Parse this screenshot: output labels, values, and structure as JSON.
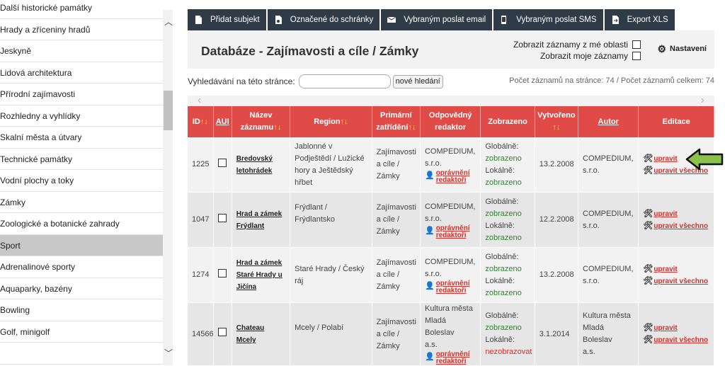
{
  "sidebar": {
    "items": [
      {
        "label": "Další historické památky"
      },
      {
        "label": "Hrady a zříceniny hradů"
      },
      {
        "label": "Jeskyně"
      },
      {
        "label": "Lidová architektura"
      },
      {
        "label": "Přírodní zajímavosti"
      },
      {
        "label": "Rozhledny a vyhlídky"
      },
      {
        "label": "Skalní města a útvary"
      },
      {
        "label": "Technické památky"
      },
      {
        "label": "Vodní plochy a toky"
      },
      {
        "label": "Zámky"
      },
      {
        "label": "Zoologické a botanické zahrady"
      },
      {
        "label": "Sport",
        "active": true
      },
      {
        "label": "Adrenalinové sporty"
      },
      {
        "label": "Aquaparky, bazény"
      },
      {
        "label": "Bowling"
      },
      {
        "label": "Golf, minigolf"
      },
      {
        "label": ""
      }
    ]
  },
  "toolbar": {
    "add": "Přidat subjekt",
    "clipboard": "Označené do schránky",
    "email": "Vybraným poslat email",
    "sms": "Vybraným poslat SMS",
    "export": "Export XLS"
  },
  "header": {
    "title": "Databáze - Zajímavosti a cíle / Zámky",
    "check_area": "Zobrazit záznamy z mé oblasti",
    "check_mine": "Zobrazit moje záznamy",
    "settings": "Nastavení"
  },
  "search": {
    "label": "Vyhledávání na této stránce:",
    "value": "",
    "button": "nové hledání",
    "count": "Počet záznamů na stránce: 74 / Počet záznamů celkem: 74"
  },
  "table": {
    "headers": {
      "id": "ID",
      "aui": "AUI",
      "name_1": "Název",
      "name_2": "záznamu",
      "region": "Region",
      "category_1": "Primární",
      "category_2": "zatřídění",
      "responsible_1": "Odpovědný",
      "responsible_2": "redaktor",
      "shown": "Zobrazeno",
      "created": "Vytvořeno",
      "author": "Autor",
      "edit": "Editace",
      "sort": "↑↓"
    },
    "perm_line1": "oprávnění",
    "perm_line2": "redaktoři",
    "global_label": "Globálně:",
    "local_label": "Lokálně:",
    "edit_label": "upravit",
    "edit_all_label": "upravit všechno",
    "rows": [
      {
        "id": "1225",
        "name_1": "Bredovský",
        "name_2": "letohrádek",
        "name_3": "",
        "region_1": "Jablonné v",
        "region_2": "Podještědí / Lužické",
        "region_3": "hory a Ještědský hřbet",
        "cat_1": "Zajímavosti",
        "cat_2": "a cíle /",
        "cat_3": "Zámky",
        "resp_1": "COMPEDIUM,",
        "resp_2": "s.r.o.",
        "resp_3": "",
        "global": "zobrazeno",
        "local": "zobrazeno",
        "local_status": "green",
        "created": "13.2.2008",
        "author_1": "COMPEDIUM,",
        "author_2": "s.r.o.",
        "author_3": ""
      },
      {
        "id": "1047",
        "name_1": "Hrad a zámek",
        "name_2": "Frýdlant",
        "name_3": "",
        "region_1": "Frýdlant / Frýdlantsko",
        "region_2": "",
        "region_3": "",
        "cat_1": "Zajímavosti",
        "cat_2": "a cíle /",
        "cat_3": "Zámky",
        "resp_1": "COMPEDIUM,",
        "resp_2": "s.r.o.",
        "resp_3": "",
        "global": "zobrazeno",
        "local": "zobrazeno",
        "local_status": "green",
        "created": "12.2.2008",
        "author_1": "COMPEDIUM,",
        "author_2": "s.r.o.",
        "author_3": ""
      },
      {
        "id": "1274",
        "name_1": "Hrad a zámek",
        "name_2": "Staré Hrady u",
        "name_3": "Jičína",
        "region_1": "Staré Hrady / Český",
        "region_2": "ráj",
        "region_3": "",
        "cat_1": "Zajímavosti",
        "cat_2": "a cíle /",
        "cat_3": "Zámky",
        "resp_1": "COMPEDIUM,",
        "resp_2": "s.r.o.",
        "resp_3": "",
        "global": "zobrazeno",
        "local": "zobrazeno",
        "local_status": "green",
        "created": "13.2.2008",
        "author_1": "COMPEDIUM,",
        "author_2": "s.r.o.",
        "author_3": ""
      },
      {
        "id": "14566",
        "name_1": "Chateau Mcely",
        "name_2": "",
        "name_3": "",
        "region_1": "Mcely / Polabí",
        "region_2": "",
        "region_3": "",
        "cat_1": "Zajímavosti",
        "cat_2": "a cíle /",
        "cat_3": "Zámky",
        "resp_1": "Kultura města",
        "resp_2": "Mladá Boleslav",
        "resp_3": "a.s.",
        "global": "zobrazeno",
        "local": "nezobrazovat",
        "local_status": "red",
        "created": "3.1.2014",
        "author_1": "Kultura města",
        "author_2": "Mladá Boleslav",
        "author_3": "a.s."
      }
    ]
  },
  "colors": {
    "header_red": "#e14b47",
    "toolbar_dark": "#2f3b47",
    "green": "#2a8a2a",
    "link_red": "#d2322d",
    "arrow_green": "#8bc34a"
  }
}
